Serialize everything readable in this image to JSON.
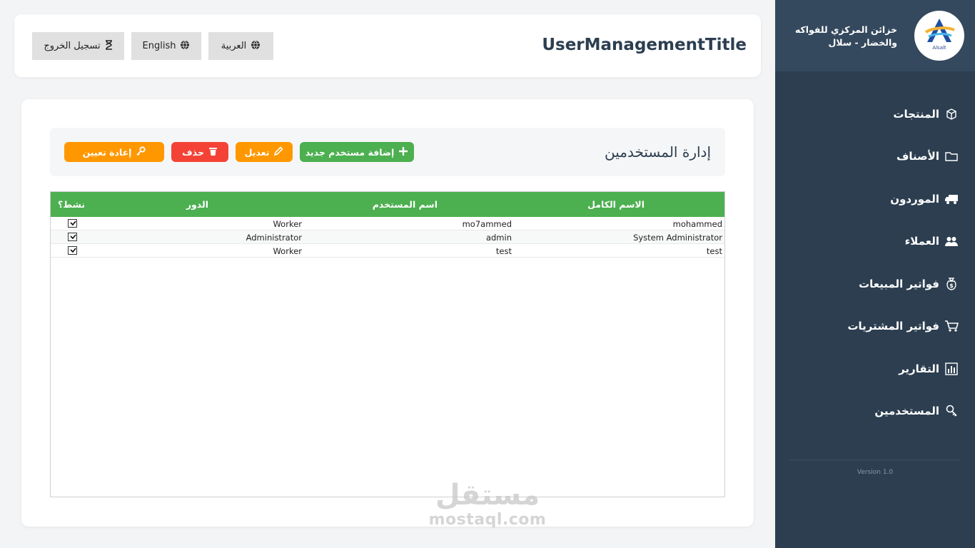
{
  "header": {
    "title": "UserManagementTitle",
    "buttons": {
      "arabic": "العربية",
      "english": "English",
      "logout": "تسجيل الخروج"
    }
  },
  "sidebar": {
    "company_line1": "خزائن المركزي للفواكه",
    "company_line2": "والخضار - سلال",
    "logo_text": "Alsalt",
    "items": [
      {
        "label": "المنتجات",
        "icon": "box-icon"
      },
      {
        "label": "الأصناف",
        "icon": "folder-icon"
      },
      {
        "label": "الموردون",
        "icon": "truck-icon"
      },
      {
        "label": "العملاء",
        "icon": "people-icon"
      },
      {
        "label": "فواتير المبيعات",
        "icon": "money-bag-icon"
      },
      {
        "label": "فواتير المشتريات",
        "icon": "cart-icon"
      },
      {
        "label": "التقارير",
        "icon": "bar-chart-icon"
      },
      {
        "label": "المستخدمين",
        "icon": "key-icon"
      }
    ],
    "version": "Version 1.0"
  },
  "main": {
    "section_title": "إدارة المستخدمين",
    "actions": {
      "add": "إضافة مستخدم جديد",
      "edit": "تعديل",
      "delete": "حذف",
      "reset": "إعادة تعيين"
    },
    "table": {
      "columns": {
        "full_name": "الاسم الكامل",
        "username": "اسم المستخدم",
        "role": "الدور",
        "active": "نشط؟"
      },
      "rows": [
        {
          "full_name": "mohammed",
          "username": "mo7ammed",
          "role": "Worker",
          "active": true
        },
        {
          "full_name": "System Administrator",
          "username": "admin",
          "role": "Administrator",
          "active": true
        },
        {
          "full_name": "test",
          "username": "test",
          "role": "Worker",
          "active": true
        }
      ]
    }
  },
  "watermark": {
    "line1": "مستقل",
    "line2": "mostaql.com"
  },
  "colors": {
    "sidebar_bg": "#2c3e50",
    "sidebar_header_bg": "#34495e",
    "green": "#4caf50",
    "orange": "#ff9800",
    "red": "#f44336"
  }
}
